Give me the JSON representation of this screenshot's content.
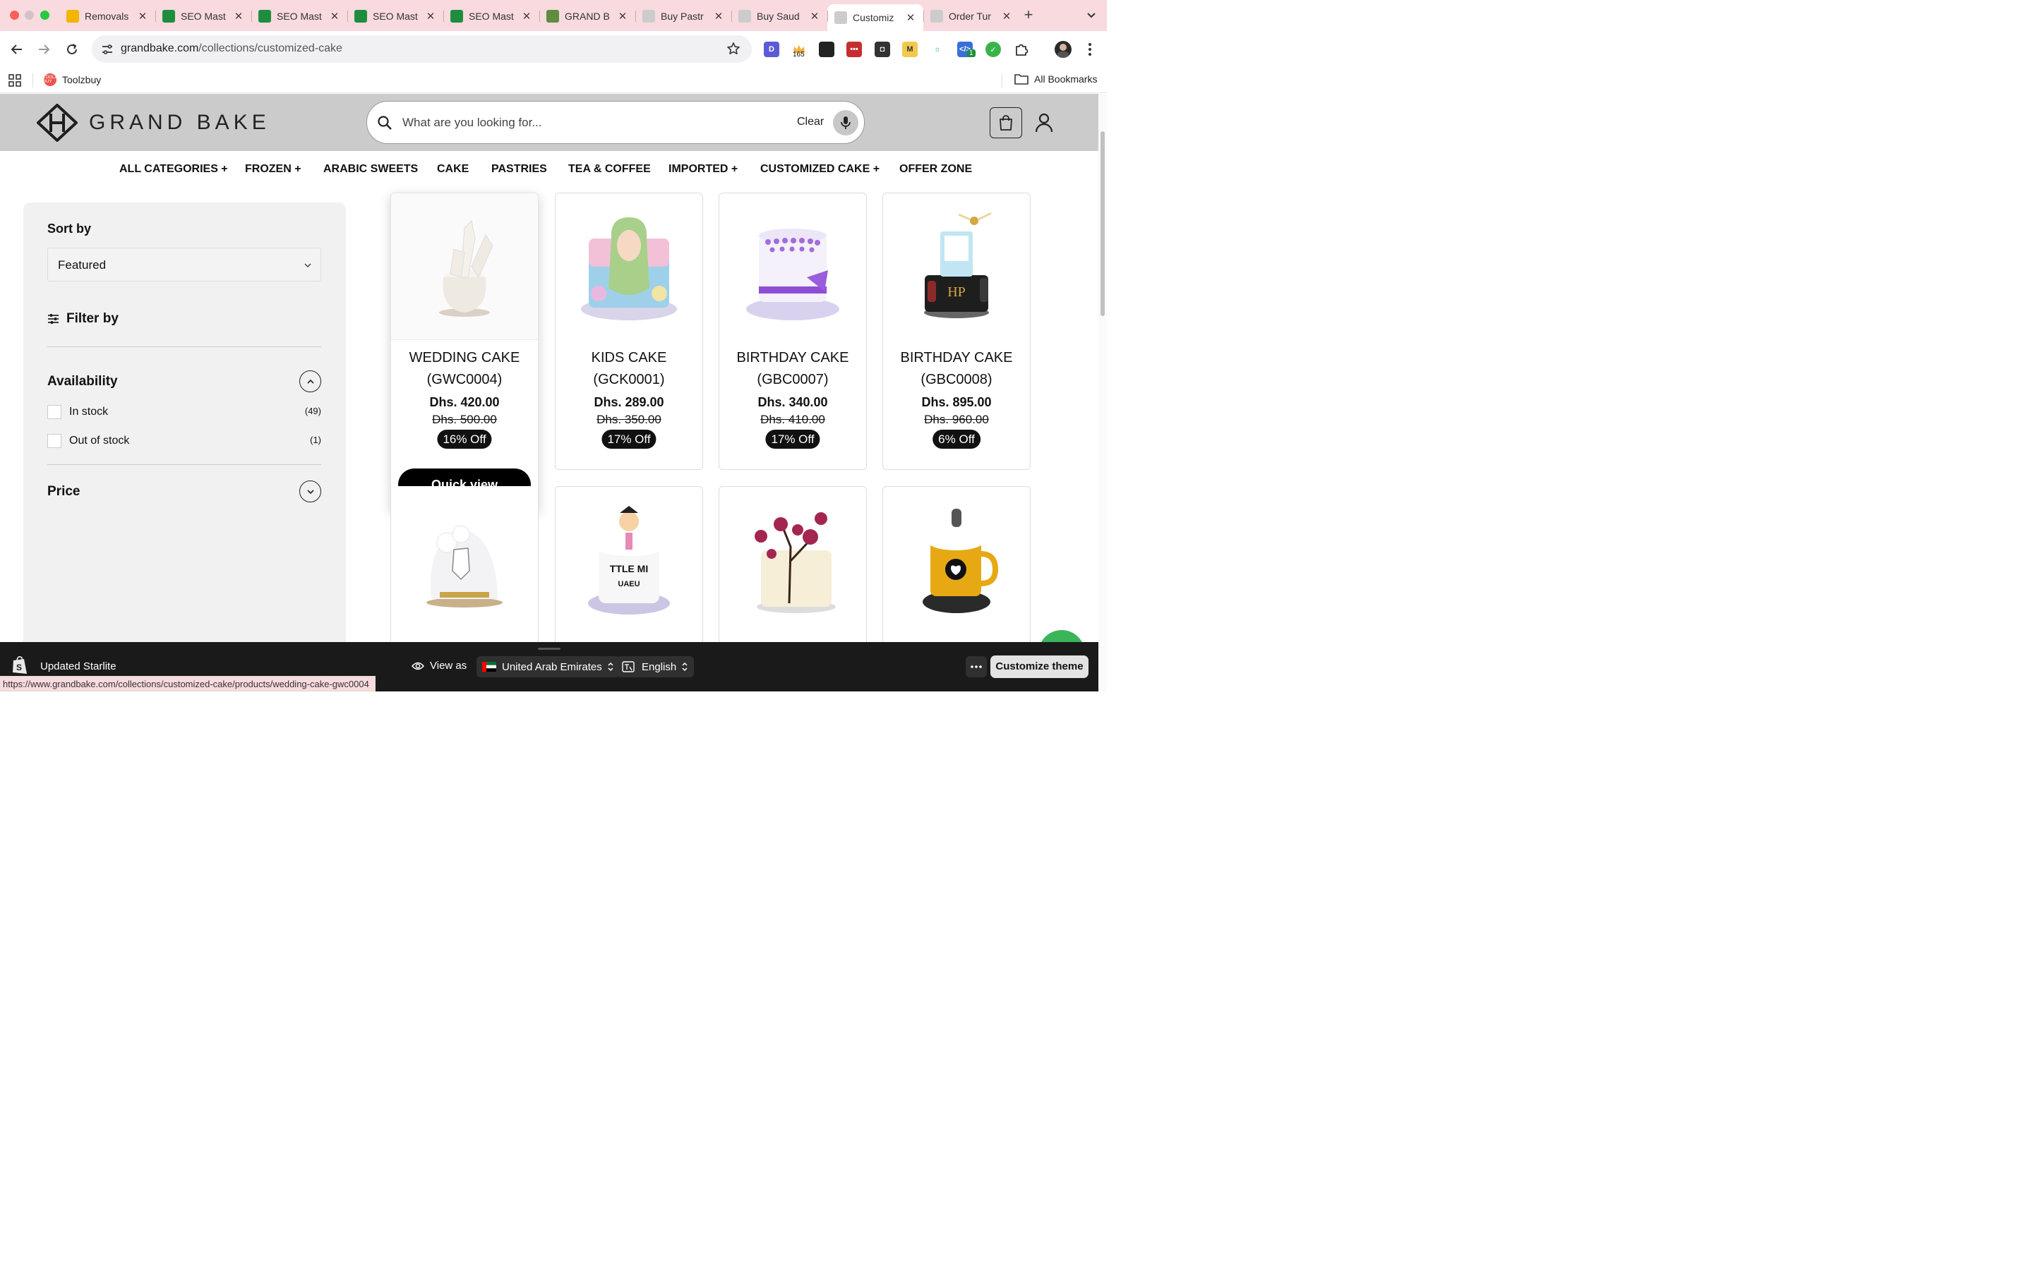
{
  "browser": {
    "tabs": [
      {
        "title": "Removals",
        "icon": "google-ads-icon",
        "color": "#f4b400"
      },
      {
        "title": "SEO Mast",
        "icon": "sheets-icon",
        "color": "#1e8e3e"
      },
      {
        "title": "SEO Mast",
        "icon": "sheets-icon",
        "color": "#1e8e3e"
      },
      {
        "title": "SEO Mast",
        "icon": "sheets-icon",
        "color": "#1e8e3e"
      },
      {
        "title": "SEO Mast",
        "icon": "sheets-icon",
        "color": "#1e8e3e"
      },
      {
        "title": "GRAND B",
        "icon": "shopify-icon",
        "color": "#5e8e3e"
      },
      {
        "title": "Buy Pastr",
        "icon": "site-icon",
        "color": "#cccccc"
      },
      {
        "title": "Buy Saud",
        "icon": "site-icon",
        "color": "#cccccc"
      },
      {
        "title": "Customiz",
        "icon": "site-icon",
        "color": "#cccccc",
        "active": true
      },
      {
        "title": "Order Tur",
        "icon": "site-icon",
        "color": "#cccccc"
      }
    ],
    "url_host": "grandbake.com",
    "url_path": "/collections/customized-cake",
    "extension_badges": {
      "counter": "165",
      "notify": "1"
    },
    "bookmark": "Toolzbuy",
    "bookmark_icon_text": "TOOLZ BUY",
    "all_bookmarks": "All Bookmarks",
    "status_url": "https://www.grandbake.com/collections/customized-cake/products/wedding-cake-gwc0004"
  },
  "site": {
    "brand": "GRAND BAKE",
    "search": {
      "placeholder": "What are you looking for...",
      "clear": "Clear"
    },
    "nav": [
      "ALL CATEGORIES +",
      "FROZEN +",
      "ARABIC SWEETS",
      "CAKE",
      "PASTRIES",
      "TEA & COFFEE",
      "IMPORTED +",
      "CUSTOMIZED CAKE +",
      "OFFER ZONE"
    ]
  },
  "sidebar": {
    "sort_label": "Sort by",
    "sort_value": "Featured",
    "filter_label": "Filter by",
    "availability": {
      "title": "Availability",
      "options": [
        {
          "label": "In stock",
          "count": "(49)"
        },
        {
          "label": "Out of stock",
          "count": "(1)"
        }
      ]
    },
    "price_title": "Price"
  },
  "products": [
    {
      "name_line1": "WEDDING CAKE",
      "name_line2": "(GWC0004)",
      "price": "Dhs. 420.00",
      "compare": "Dhs. 500.00",
      "badge": "16% Off",
      "quick_view": "Quick view"
    },
    {
      "name_line1": "KIDS CAKE",
      "name_line2": "(GCK0001)",
      "price": "Dhs. 289.00",
      "compare": "Dhs. 350.00",
      "badge": "17% Off"
    },
    {
      "name_line1": "BIRTHDAY CAKE",
      "name_line2": "(GBC0007)",
      "price": "Dhs. 340.00",
      "compare": "Dhs. 410.00",
      "badge": "17% Off"
    },
    {
      "name_line1": "BIRTHDAY CAKE",
      "name_line2": "(GBC0008)",
      "price": "Dhs. 895.00",
      "compare": "Dhs. 960.00",
      "badge": "6% Off"
    }
  ],
  "editor": {
    "theme_name": "Updated Starlite",
    "view_as": "View as",
    "country": "United Arab Emirates",
    "language": "English",
    "customize": "Customize theme"
  },
  "colors": {
    "tabbar_bg": "#f8dadf",
    "header_bg": "#cbcbcb",
    "sidebar_bg": "#f1f1f1",
    "badge_bg": "#111111",
    "editor_bg": "#1a1a1a"
  }
}
